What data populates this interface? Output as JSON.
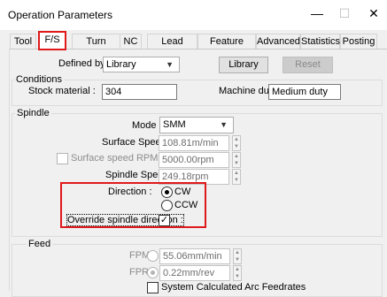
{
  "window": {
    "title": "Operation Parameters",
    "minimize_glyph": "—",
    "maximize_glyph": "☐",
    "close_glyph": "✕"
  },
  "tabs": [
    {
      "label": "Tool",
      "active": false
    },
    {
      "label": "F/S",
      "active": true
    },
    {
      "label": "Turn Rough",
      "active": false
    },
    {
      "label": "NC",
      "active": false
    },
    {
      "label": "Lead In/Out",
      "active": false
    },
    {
      "label": "Feature Options",
      "active": false
    },
    {
      "label": "Advanced",
      "active": false
    },
    {
      "label": "Statistics",
      "active": false
    },
    {
      "label": "Posting",
      "active": false
    }
  ],
  "defined_by": {
    "label": "Defined by :",
    "value": "Library",
    "library_button": "Library",
    "reset_button": "Reset"
  },
  "conditions": {
    "group_label": "Conditions",
    "stock_material_label": "Stock material :",
    "stock_material_value": "304",
    "machine_duty_label": "Machine duty :",
    "machine_duty_value": "Medium duty"
  },
  "spindle": {
    "group_label": "Spindle",
    "mode_label": "Mode :",
    "mode_value": "SMM",
    "surface_speed_label": "Surface Speed :",
    "surface_speed_value": "108.81m/min",
    "rpm_max_label": "Surface speed RPM max :",
    "rpm_max_value": "5000.00rpm",
    "spindle_speed_label": "Spindle Speed :",
    "spindle_speed_value": "249.18rpm",
    "direction_label": "Direction :",
    "cw_label": "CW",
    "ccw_label": "CCW",
    "direction_selected": "CW",
    "override_label": "Override spindle direction :",
    "override_checked": true
  },
  "feed": {
    "group_label": "Feed",
    "fpm_label": "FPM",
    "fpm_value": "55.06mm/min",
    "fpr_label": "FPR",
    "fpr_value": "0.22mm/rev",
    "arc_label": "System Calculated Arc Feedrates"
  },
  "colors": {
    "highlight": "#e0191b"
  }
}
